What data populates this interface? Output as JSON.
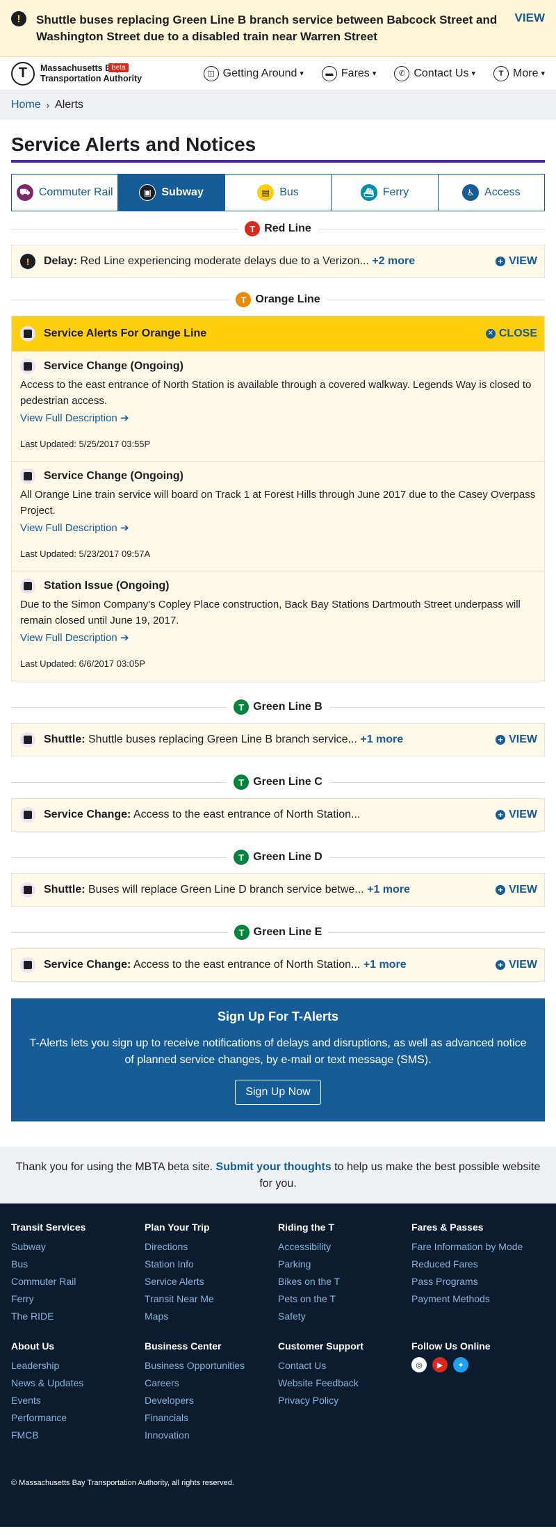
{
  "banner": {
    "text": "Shuttle buses replacing Green Line B branch service between Babcock Street and Washington Street due to a disabled train near Warren Street",
    "view": "VIEW"
  },
  "header": {
    "logo_line1": "Massachusetts Bay",
    "logo_line2": "Transportation Authority",
    "beta": "Beta",
    "nav": [
      "Getting Around",
      "Fares",
      "Contact Us",
      "More"
    ]
  },
  "breadcrumb": {
    "home": "Home",
    "current": "Alerts"
  },
  "title": "Service Alerts and Notices",
  "tabs": [
    {
      "label": "Commuter Rail",
      "color": "#80276c"
    },
    {
      "label": "Subway",
      "color": "#1c1e23"
    },
    {
      "label": "Bus",
      "color": "#ffce0c"
    },
    {
      "label": "Ferry",
      "color": "#008eaa"
    },
    {
      "label": "Access",
      "color": "#165c96"
    }
  ],
  "lines": {
    "red": {
      "name": "Red Line",
      "color": "#da291c",
      "alert": {
        "type": "Delay:",
        "text": "Red Line experiencing moderate delays due to a Verizon...",
        "more": "+2 more",
        "view": "VIEW"
      }
    },
    "orange": {
      "name": "Orange Line",
      "color": "#ed8b00",
      "header": "Service Alerts For Orange Line",
      "close": "CLOSE",
      "entries": [
        {
          "title": "Service Change (Ongoing)",
          "text": "Access to the east entrance of North Station is available through a covered walkway. Legends Way is closed to pedestrian access.",
          "link": "View Full Description",
          "updated": "Last Updated: 5/25/2017 03:55P"
        },
        {
          "title": "Service Change (Ongoing)",
          "text": "All Orange Line train service will board on Track 1 at Forest Hills through June 2017 due to the Casey Overpass Project.",
          "link": "View Full Description",
          "updated": "Last Updated: 5/23/2017 09:57A"
        },
        {
          "title": "Station Issue (Ongoing)",
          "text": "Due to the Simon Company's Copley Place construction, Back Bay Stations Dartmouth Street underpass will remain closed until June 19, 2017.",
          "link": "View Full Description",
          "updated": "Last Updated: 6/6/2017 03:05P"
        }
      ]
    },
    "gb": {
      "name": "Green Line B",
      "color": "#00843d",
      "alert": {
        "type": "Shuttle:",
        "text": "Shuttle buses replacing Green Line B branch service...",
        "more": "+1 more",
        "view": "VIEW"
      }
    },
    "gc": {
      "name": "Green Line C",
      "color": "#00843d",
      "alert": {
        "type": "Service Change:",
        "text": "Access to the east entrance of North Station...",
        "more": "",
        "view": "VIEW"
      }
    },
    "gd": {
      "name": "Green Line D",
      "color": "#00843d",
      "alert": {
        "type": "Shuttle:",
        "text": "Buses will replace Green Line D branch service betwe...",
        "more": "+1 more",
        "view": "VIEW"
      }
    },
    "ge": {
      "name": "Green Line E",
      "color": "#00843d",
      "alert": {
        "type": "Service Change:",
        "text": "Access to the east entrance of North Station...",
        "more": "+1 more",
        "view": "VIEW"
      }
    }
  },
  "signup": {
    "title": "Sign Up For T-Alerts",
    "text": "T-Alerts lets you sign up to receive notifications of delays and disruptions, as well as advanced notice of planned service changes, by e-mail or text message (SMS).",
    "button": "Sign Up Now"
  },
  "thanks": {
    "pre": "Thank you for using the MBTA beta site.",
    "link": "Submit your thoughts",
    "post": "to help us make the best possible website for you."
  },
  "footer": {
    "cols": [
      {
        "title": "Transit Services",
        "links": [
          "Subway",
          "Bus",
          "Commuter Rail",
          "Ferry",
          "The RIDE"
        ]
      },
      {
        "title": "Plan Your Trip",
        "links": [
          "Directions",
          "Station Info",
          "Service Alerts",
          "Transit Near Me",
          "Maps"
        ]
      },
      {
        "title": "Riding the T",
        "links": [
          "Accessibility",
          "Parking",
          "Bikes on the T",
          "Pets on the T",
          "Safety"
        ]
      },
      {
        "title": "Fares & Passes",
        "links": [
          "Fare Information by Mode",
          "Reduced Fares",
          "Pass Programs",
          "Payment Methods"
        ]
      },
      {
        "title": "About Us",
        "links": [
          "Leadership",
          "News & Updates",
          "Events",
          "Performance",
          "FMCB"
        ]
      },
      {
        "title": "Business Center",
        "links": [
          "Business Opportunities",
          "Careers",
          "Developers",
          "Financials",
          "Innovation"
        ]
      },
      {
        "title": "Customer Support",
        "links": [
          "Contact Us",
          "Website Feedback",
          "Privacy Policy"
        ]
      }
    ],
    "follow": "Follow Us Online",
    "copyright": "© Massachusetts Bay Transportation Authority, all rights reserved."
  }
}
